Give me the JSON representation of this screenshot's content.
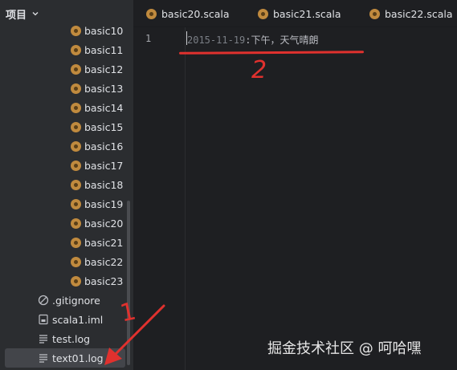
{
  "sidebar": {
    "title": "项目",
    "tree": [
      {
        "label": "basic10",
        "kind": "scala"
      },
      {
        "label": "basic11",
        "kind": "scala"
      },
      {
        "label": "basic12",
        "kind": "scala"
      },
      {
        "label": "basic13",
        "kind": "scala"
      },
      {
        "label": "basic14",
        "kind": "scala"
      },
      {
        "label": "basic15",
        "kind": "scala"
      },
      {
        "label": "basic16",
        "kind": "scala"
      },
      {
        "label": "basic17",
        "kind": "scala"
      },
      {
        "label": "basic18",
        "kind": "scala"
      },
      {
        "label": "basic19",
        "kind": "scala"
      },
      {
        "label": "basic20",
        "kind": "scala"
      },
      {
        "label": "basic21",
        "kind": "scala"
      },
      {
        "label": "basic22",
        "kind": "scala"
      },
      {
        "label": "basic23",
        "kind": "scala"
      },
      {
        "label": ".gitignore",
        "kind": "ignore"
      },
      {
        "label": "scala1.iml",
        "kind": "iml"
      },
      {
        "label": "test.log",
        "kind": "log"
      },
      {
        "label": "text01.log",
        "kind": "log",
        "selected": true
      }
    ]
  },
  "tabs": [
    {
      "label": "basic20.scala"
    },
    {
      "label": "basic21.scala"
    },
    {
      "label": "basic22.scala"
    }
  ],
  "editor": {
    "line_number": "1",
    "code_date": "2015-11-19",
    "code_rest": ":下午，天气晴朗"
  },
  "annotations": {
    "mark_1": "1",
    "mark_2": "2",
    "color": "#e0312e"
  },
  "watermark": "掘金技术社区 @ 呵哈嘿",
  "colors": {
    "sidebar_bg": "#2b2d30",
    "editor_bg": "#1e1f22",
    "scala_icon": "#c08a3e",
    "selection": "#43454a"
  }
}
